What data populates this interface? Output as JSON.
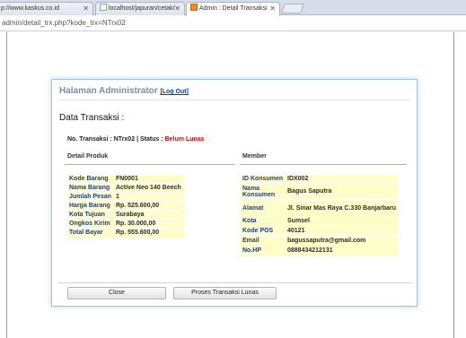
{
  "browser": {
    "tabs": [
      {
        "label": "p://www.kaskus.co.id"
      },
      {
        "label": "localhost/japuran/cetak/"
      },
      {
        "label": "Admin : Detail Transaksi"
      }
    ],
    "url": "admin/detail_trx.php?kode_trx=NTrx02"
  },
  "header": {
    "title": "Halaman Administrator",
    "logout_label": "[Log Out]"
  },
  "section_title": "Data Transaksi :",
  "transaction": {
    "no_label": "No. Transaksi :",
    "no_value": "NTrx02",
    "separator": "|",
    "status_label": "Status :",
    "status_value": "Belum Lunas"
  },
  "product": {
    "heading": "Detail Produk",
    "rows": [
      {
        "key": "Kode Barang",
        "value": "FN0001"
      },
      {
        "key": "Nama Barang",
        "value": "Active Neo 140 Beech"
      },
      {
        "key": "Jumlah Pesan",
        "value": "1"
      },
      {
        "key": "Harga Barang",
        "value": "Rp. 525.600,00"
      },
      {
        "key": "Kota Tujuan",
        "value": "Surabaya"
      },
      {
        "key": "Ongkos Kirim",
        "value": "Rp. 30.000,00"
      },
      {
        "key": "Total Bayar",
        "value": "Rp. 555.600,00"
      }
    ]
  },
  "member": {
    "heading": "Member",
    "rows": [
      {
        "key": "ID Konsumen",
        "value": "IDX002"
      },
      {
        "key": "Nama Konsumen",
        "value": "Bagus Saputra"
      },
      {
        "key": "Alamat",
        "value": "Jl. Sinar Mas Raya C.330 Banjarbaru"
      },
      {
        "key": "Kota",
        "value": "Sumsel"
      },
      {
        "key": "Kode POS",
        "value": "40121"
      },
      {
        "key": "Email",
        "value": "bagussaputra@gmail.com"
      },
      {
        "key": "No.HP",
        "value": "0888434212131"
      }
    ]
  },
  "buttons": {
    "close_label": "Close",
    "process_label": "Proses Transaksi Lunas"
  }
}
